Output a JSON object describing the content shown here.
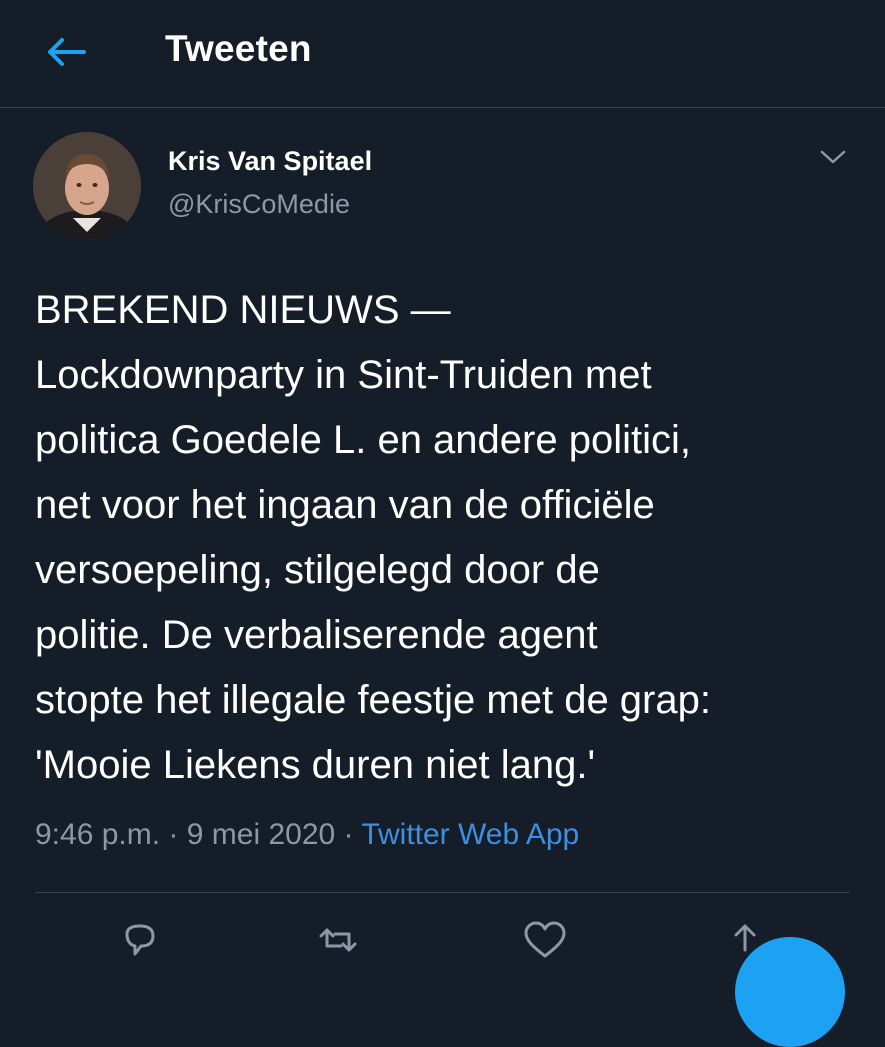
{
  "header": {
    "title": "Tweeten",
    "back_icon": "arrow-left-icon",
    "accent_color": "#1da1f2"
  },
  "tweet": {
    "author_name": "Kris Van Spitael",
    "author_handle": "@KrisCoMedie",
    "text": "BREKEND NIEUWS —\nLockdownparty in Sint-Truiden met\npolitica Goedele L. en andere politici,\nnet voor het ingaan van de officiële\nversoepeling, stilgelegd door de\npolitie. De verbaliserende agent\nstopte het illegale feestje met de grap:\n'Mooie Liekens duren niet lang.'",
    "time": "9:46 p.m.",
    "separator": " · ",
    "date": "9 mei 2020",
    "source": "Twitter Web App"
  },
  "actions": {
    "icons": [
      "reply-icon",
      "retweet-icon",
      "like-icon",
      "share-icon"
    ]
  }
}
